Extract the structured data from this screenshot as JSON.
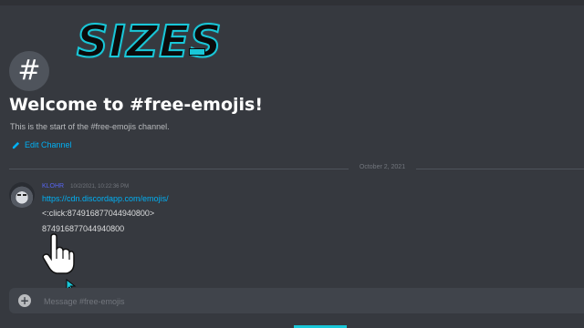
{
  "overlay": {
    "title": "SIZES"
  },
  "channel": {
    "hash_symbol": "#",
    "welcome": "Welcome to #free-emojis!",
    "start_text": "This is the start of the #free-emojis channel.",
    "edit_label": "Edit Channel"
  },
  "divider": {
    "date": "October 2, 2021"
  },
  "message": {
    "username": "KLOHR",
    "timestamp": "10/2/2021, 10:22:36 PM",
    "link": "https://cdn.discordapp.com/emojis/",
    "click_tag": "<:click:874916877044940800>",
    "id_text": "874916877044940800"
  },
  "composer": {
    "placeholder": "Message #free-emojis"
  },
  "colors": {
    "accent": "#19c7d8",
    "link": "#00b0f4",
    "background": "#36393f",
    "username": "#5865f2"
  },
  "icons": {
    "channel": "hash-icon",
    "edit": "pencil-icon",
    "add": "plus-circle-icon",
    "cursor": "hand-pointer-icon"
  }
}
